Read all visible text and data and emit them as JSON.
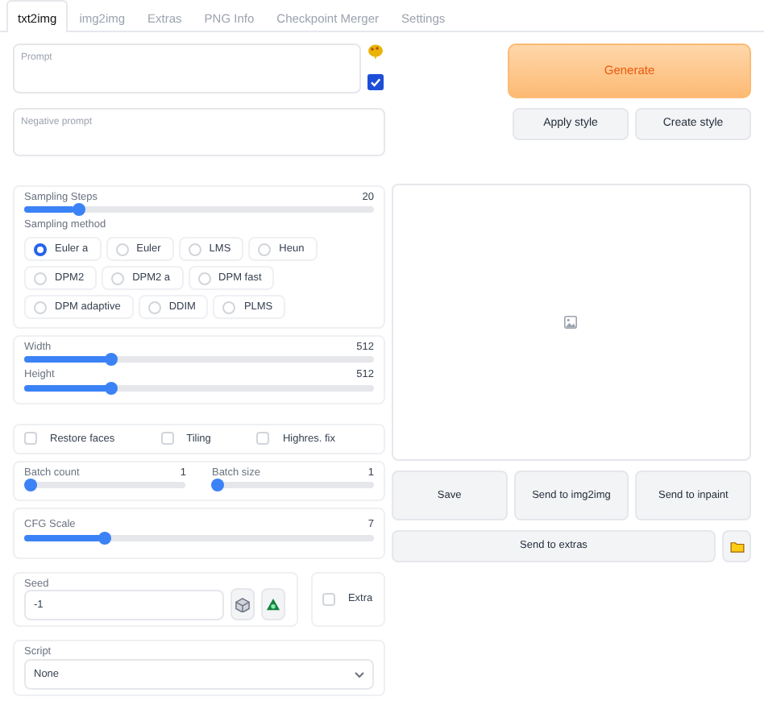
{
  "tabs": [
    {
      "label": "txt2img",
      "selected": true
    },
    {
      "label": "img2img",
      "selected": false
    },
    {
      "label": "Extras",
      "selected": false
    },
    {
      "label": "PNG Info",
      "selected": false
    },
    {
      "label": "Checkpoint Merger",
      "selected": false
    },
    {
      "label": "Settings",
      "selected": false
    }
  ],
  "prompt": {
    "placeholder": "Prompt"
  },
  "negative_prompt": {
    "placeholder": "Negative prompt"
  },
  "generate_button": "Generate",
  "style_buttons": [
    "Apply style",
    "Create style"
  ],
  "sampling_steps": {
    "label": "Sampling Steps",
    "value": "20",
    "level": 0.145
  },
  "sampling_method": {
    "label": "Sampling method",
    "options": [
      {
        "label": "Euler a",
        "selected": true
      },
      {
        "label": "Euler",
        "selected": false
      },
      {
        "label": "LMS",
        "selected": false
      },
      {
        "label": "Heun",
        "selected": false
      },
      {
        "label": "DPM2",
        "selected": false
      },
      {
        "label": "DPM2 a",
        "selected": false
      },
      {
        "label": "DPM fast",
        "selected": false
      },
      {
        "label": "DPM adaptive",
        "selected": false
      },
      {
        "label": "DDIM",
        "selected": false
      },
      {
        "label": "PLMS",
        "selected": false
      }
    ]
  },
  "size_sliders": [
    {
      "label": "Width",
      "value": "512",
      "level": 0.24
    },
    {
      "label": "Height",
      "value": "512",
      "level": 0.24
    }
  ],
  "options": [
    {
      "label": "Restore faces",
      "checked": false
    },
    {
      "label": "Tiling",
      "checked": false
    },
    {
      "label": "Highres. fix",
      "checked": false
    }
  ],
  "batch_sliders": [
    {
      "label": "Batch count",
      "value": "1",
      "level": 0
    },
    {
      "label": "Batch size",
      "value": "1",
      "level": 0
    }
  ],
  "cfg_scale": {
    "label": "CFG Scale",
    "value": "7",
    "level": 0.22
  },
  "seed": {
    "label": "Seed",
    "value": "-1"
  },
  "extra": {
    "label": "Extra",
    "checked": false
  },
  "script": {
    "label": "Script",
    "value": "None"
  },
  "output_buttons": [
    "Save",
    "Send to img2img",
    "Send to inpaint"
  ],
  "send_to_extras": "Send to extras"
}
